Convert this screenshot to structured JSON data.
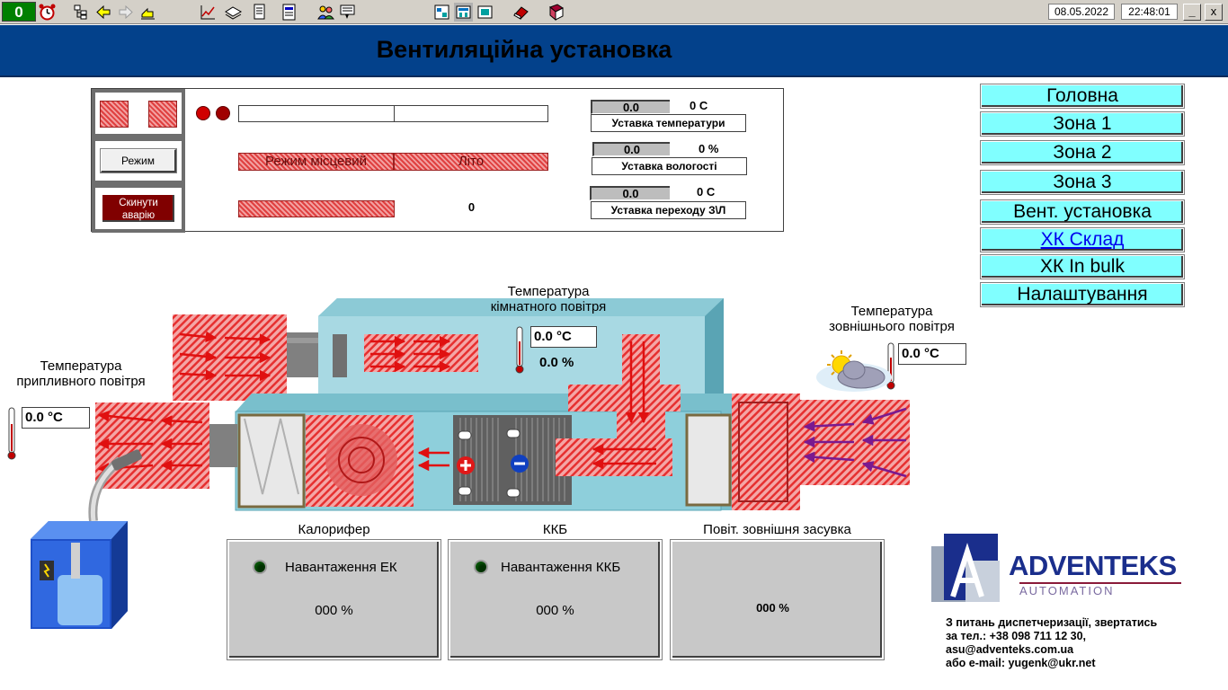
{
  "toolbar": {
    "counter": "0",
    "date": "08.05.2022",
    "time": "22:48:01",
    "minimize_label": "_",
    "close_label": "x",
    "icons": [
      "alarm-clock-icon",
      "tree-icon",
      "back-icon",
      "forward-icon",
      "home-icon",
      "trend-icon",
      "layers-icon",
      "document-icon",
      "report-icon",
      "users-icon",
      "network-icon",
      "screen1-icon",
      "screen2-icon",
      "screen3-icon",
      "eraser-icon",
      "book-icon"
    ]
  },
  "header": {
    "title": "Вентиляційна установка"
  },
  "panel": {
    "mode_button": "Режим",
    "reset_button": "Скинути аварію",
    "mode_status": "Режим місцевий",
    "season_status": "Літо",
    "counter_value": "0",
    "setpoints": [
      {
        "value": "0.0",
        "unit": "0  С",
        "label": "Уставка температури"
      },
      {
        "value": "0.0",
        "unit": "0 %",
        "label": "Уставка вологості"
      },
      {
        "value": "0.0",
        "unit": "0  С",
        "label": "Уставка переходу З\\Л"
      }
    ]
  },
  "nav": {
    "items": [
      {
        "label": "Головна"
      },
      {
        "label": "Зона 1"
      },
      {
        "label": "Зона 2"
      },
      {
        "label": "Зона 3"
      },
      {
        "label": "Вент. установка"
      },
      {
        "label": "ХК Склад"
      },
      {
        "label": "ХК In bulk"
      },
      {
        "label": "Налаштування"
      }
    ]
  },
  "diagram": {
    "room_temp_label": "Температура\nкімнатного повітря",
    "room_temp_value": "0.0 °C",
    "room_humidity_value": "0.0 %",
    "supply_temp_label": "Температура\nприпливного повітря",
    "supply_temp_value": "0.0 °C",
    "outdoor_temp_label": "Температура\nзовнішнього повітря",
    "outdoor_temp_value": "0.0 °C"
  },
  "bottom": {
    "heater": {
      "title": "Калорифер",
      "load_label": "Навантаження ЕК",
      "value": "000 %"
    },
    "cooler": {
      "title": "ККБ",
      "load_label": "Навантаження ККБ",
      "value": "000 %"
    },
    "damper": {
      "title": "Повіт. зовнішня засувка",
      "value": "000 %"
    }
  },
  "logo": {
    "name": "ADVENTEKS",
    "sub": "AUTOMATION"
  },
  "contact": {
    "line1": "З питань диспетчеризації, звертатись",
    "line2": "за тел.: +38 098 711 12 30,",
    "line3": "asu@adventeks.com.ua",
    "line4": "або e-mail: yugenk@ukr.net"
  },
  "colors": {
    "header": "#03418b",
    "nav": "#80ffff",
    "airflow": "#e02020",
    "unit_body": "#7fbfcc"
  }
}
